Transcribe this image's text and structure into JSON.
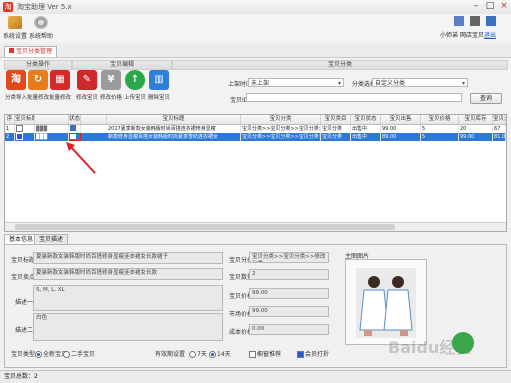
{
  "window": {
    "title": "淘宝助理 Ver 5.x"
  },
  "menu": {
    "items": [
      {
        "label": "系统设置",
        "icon": "tools-icon"
      },
      {
        "label": "系统帮助",
        "icon": "gear-icon"
      }
    ]
  },
  "account": {
    "label": "小师弟",
    "link": "登录",
    "nick": "网店宝贝",
    "logout": "退出"
  },
  "tabs": {
    "active": "宝贝分类管理"
  },
  "toolbar": {
    "sections": [
      {
        "label": "分类操作"
      },
      {
        "label": "宝贝编辑"
      },
      {
        "label": "宝贝分类"
      }
    ],
    "buttons": [
      {
        "label": "分类导入",
        "icon": "taobao-icon",
        "color": "#e2481d",
        "glyph": "淘"
      },
      {
        "label": "批量修改",
        "icon": "refresh-icon",
        "color": "#e87b1c",
        "glyph": "↻"
      },
      {
        "label": "批量修改",
        "icon": "dice-icon",
        "color": "#d62b2b",
        "glyph": "▦"
      },
      {
        "label": "修改宝贝",
        "icon": "edit-icon",
        "color": "#cc2a2a",
        "glyph": "✎"
      },
      {
        "label": "修改价格",
        "icon": "price-icon",
        "color": "#9b9b9b",
        "glyph": "¥"
      },
      {
        "label": "上传宝贝",
        "icon": "upload-icon",
        "color": "#2aa84a",
        "glyph": "↑"
      },
      {
        "label": "删除宝贝",
        "icon": "trash-icon",
        "color": "#2f7ed8",
        "glyph": "▥"
      }
    ],
    "category_label": "上架时间",
    "category_value": "未上架",
    "shop_label": "分类选择",
    "shop_value": "自定义分类",
    "search_label": "宝贝ID",
    "search_value": "",
    "query_button": "查询"
  },
  "grid": {
    "columns": [
      "序",
      "宝贝标题",
      "状态",
      "",
      "宝贝标题",
      "宝贝分类",
      "宝贝类目",
      "宝贝状态",
      "宝贝出售",
      "宝贝价格",
      "宝贝库存",
      "宝贝运费",
      "宝贝销量"
    ],
    "rows": [
      {
        "no": "1",
        "thumb": "▉▉▉",
        "status": "",
        "title": "2017夏季新款女装韩版时尚百搭连衣裙修身显瘦",
        "category": "宝贝分类>>宝贝分类>>宝贝分类>>修改分类",
        "cat2": "宝贝分类",
        "sell": "出售中",
        "price": "99.00",
        "stock": "5",
        "fee": "0",
        "sales": "20",
        "last": "67",
        "selected": false
      },
      {
        "no": "2",
        "thumb": "▉▉▉",
        "status": "",
        "title": "新款修身显瘦百搭女装韩版时尚夏季雪纺连衣裙女",
        "category": "宝贝分类>>宝贝分类>>宝贝分类>>修改分类",
        "cat2": "宝贝分类",
        "sell": "出售中",
        "price": "89.00",
        "stock": "5",
        "fee": "0",
        "sales": "99.00",
        "last": "81.00",
        "selected": true
      }
    ]
  },
  "detail": {
    "tabs": [
      "基本信息",
      "宝贝描述"
    ],
    "title_label": "宝贝标题",
    "title_value": "夏装新款女装韩版时尚百搭修身显瘦连衣裙女长款裙子",
    "subtitle_label": "宝贝卖点",
    "subtitle_value": "夏装新款女装韩版时尚百搭修身显瘦连衣裙女长款",
    "desc1_label": "描述一",
    "desc1_value": "S, M, L, XL",
    "desc2_label": "描述二",
    "desc2_value": "白色",
    "category_label": "宝贝分类",
    "category_value": "宝贝分类>>宝贝分类>>修改分类",
    "qty_label": "宝贝数量",
    "qty_value": "2",
    "price_label": "宝贝价格",
    "price_value": "99.00",
    "market_label": "市场价格",
    "market_value": "99.00",
    "cost_label": "成本价格",
    "cost_value": "0.00",
    "image_label": "主图图片",
    "method_label": "宝贝类型",
    "method_options": [
      "全新宝贝",
      "二手宝贝"
    ],
    "valid_label": "有效期设置",
    "valid_options": [
      "7天",
      "14天"
    ],
    "chk1": "橱窗推荐",
    "chk2": "会员打折"
  },
  "status": {
    "text": "宝贝总数：2"
  },
  "watermark": "Baidu经验"
}
